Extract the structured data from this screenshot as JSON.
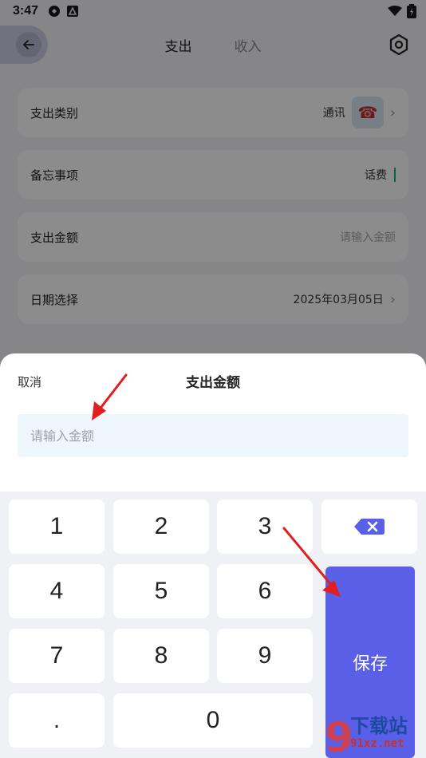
{
  "status_bar": {
    "time": "3:47"
  },
  "nav": {
    "tabs": [
      {
        "label": "支出",
        "active": true
      },
      {
        "label": "收入",
        "active": false
      }
    ]
  },
  "form": {
    "category": {
      "label": "支出类别",
      "value": "通讯",
      "icon": "telephone-icon"
    },
    "memo": {
      "label": "备忘事项",
      "value": "话费"
    },
    "amount": {
      "label": "支出金额",
      "placeholder": "请输入金额"
    },
    "date": {
      "label": "日期选择",
      "value": "2025年03月05日"
    }
  },
  "sheet": {
    "cancel_label": "取消",
    "title": "支出金额",
    "input_placeholder": "请输入金额",
    "input_value": ""
  },
  "keypad": {
    "keys": [
      "1",
      "2",
      "3",
      "4",
      "5",
      "6",
      "7",
      "8",
      "9",
      ".",
      "0"
    ],
    "save_label": "保存",
    "delete_icon": "backspace-icon"
  },
  "watermark": {
    "brand": "下载站",
    "url": "91xz.net"
  },
  "colors": {
    "accent": "#5a5fe8",
    "arrow": "#e02020",
    "input_bg": "#eef7fc"
  }
}
